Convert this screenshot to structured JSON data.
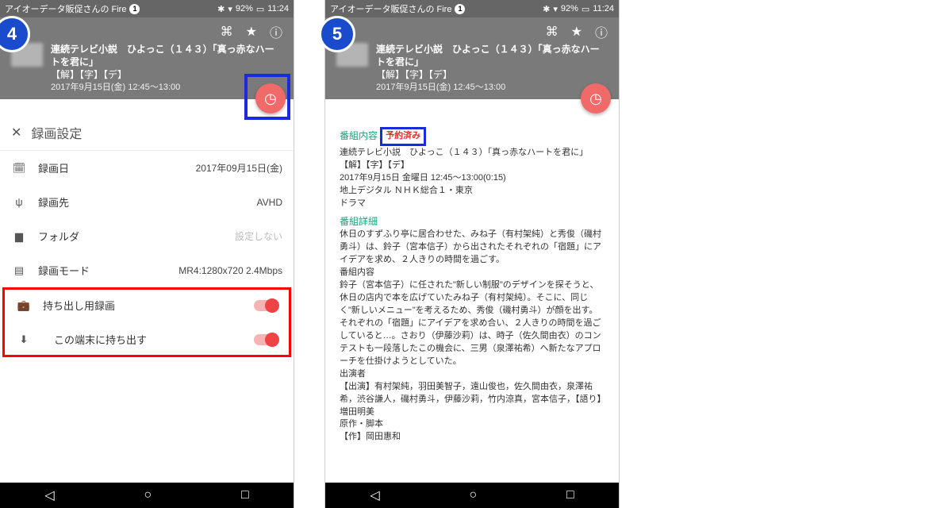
{
  "status": {
    "app": "アイオーデータ販促さんの Fire",
    "badge": "1",
    "battery": "92%",
    "time": "11:24"
  },
  "program": {
    "title": "連続テレビ小説　ひよっこ（１４３）「真っ赤なハートを君に」",
    "tags": "【解】【字】【デ】",
    "datetime": "2017年9月15日(金) 12:45～13:00"
  },
  "left": {
    "badge": "4",
    "settings_title": "録画設定",
    "rows": {
      "date_label": "録画日",
      "date_val": "2017年09月15日(金)",
      "dest_label": "録画先",
      "dest_val": "AVHD",
      "folder_label": "フォルダ",
      "folder_val": "設定しない",
      "mode_label": "録画モード",
      "mode_val": "MR4:1280x720 2.4Mbps",
      "take_label": "持ち出し用録画",
      "device_label": "この端末に持ち出す"
    }
  },
  "right": {
    "badge": "5",
    "sect1": "番組内容",
    "reserved": "予約済み",
    "line1": "連続テレビ小説　ひよっこ（１４３）「真っ赤なハートを君に」【解】【字】【デ】",
    "line2": "2017年9月15日 金曜日 12:45～13:00(0:15)",
    "line3": "地上デジタル ＮＨＫ総合１・東京",
    "line4": "ドラマ",
    "sect2": "番組詳細",
    "detail1": "休日のすずふり亭に居合わせた、みね子（有村架純）と秀俊（磯村勇斗）は、鈴子（宮本信子）から出されたそれぞれの「宿題」にアイデアを求め、２人きりの時間を過ごす。",
    "detail1b": "番組内容",
    "detail2": "鈴子（宮本信子）に任された\"新しい制服\"のデザインを探そうと、休日の店内で本を広げていたみね子（有村架純）。そこに、同じく\"新しいメニュー\"を考えるため、秀俊（磯村勇斗）が顔を出す。それぞれの「宿題」にアイデアを求め合い、２人きりの時間を過ごしていると…。さおり（伊藤沙莉）は、時子（佐久間由衣）のコンテストも一段落したこの機会に、三男（泉澤祐希）へ新たなアプローチを仕掛けようとしていた。",
    "detail2b": "出演者",
    "detail3": "【出演】有村架純，羽田美智子，遠山俊也，佐久間由衣，泉澤祐希，渋谷謙人，磯村勇斗，伊藤沙莉，竹内涼真，宮本信子，【語り】増田明美",
    "detail3b": "原作・脚本",
    "detail4": "【作】岡田惠和"
  }
}
